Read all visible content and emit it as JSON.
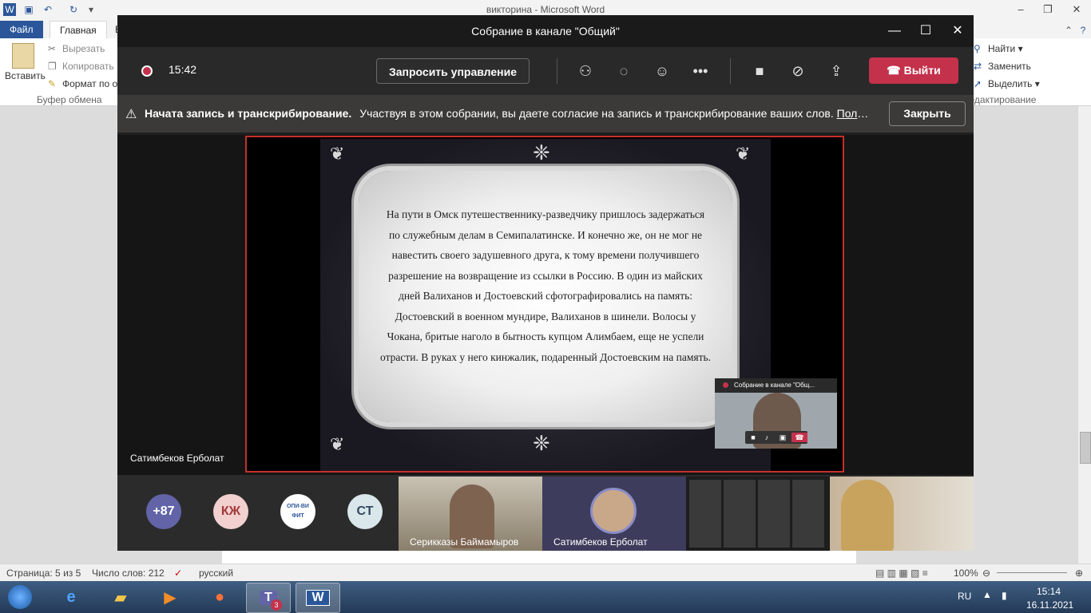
{
  "word": {
    "title": "викторина  -  Microsoft Word",
    "tabs": [
      "Файл",
      "Главная",
      "В"
    ],
    "clipboard": {
      "paste": "Вставить",
      "cut": "Вырезать",
      "copy": "Копировать",
      "format": "Формат по об",
      "group": "Буфер обмена"
    },
    "editing": {
      "find": "Найти",
      "replace": "Заменить",
      "select": "Выделить",
      "group": "Редактирование"
    },
    "status": {
      "page": "Страница: 5 из 5",
      "words": "Число слов: 212",
      "language": "русский",
      "zoom": "100%"
    }
  },
  "teams": {
    "title": "Собрание в канале \"Общий\"",
    "timer": "15:42",
    "request_control": "Запросить управление",
    "leave": "Выйти",
    "banner": {
      "bold": "Начата запись и транскрибирование.",
      "text": "Участвуя в этом собрании, вы даете согласие на запись и транскрибирование ваших слов.",
      "link": "Полити...",
      "close": "Закрыть"
    },
    "slide_text": "На пути в Омск путешественнику-разведчику пришлось задержаться по служебным делам в Семипалатинске. И конечно же, он не мог не навестить своего задушевного друга, к тому времени получившего разрешение на возвращение из ссылки в Россию. В один из майских дней Валиханов и Достоевский сфотографировались на память: Достоевский в военном мундире, Валиханов в шинели. Волосы у Чокана, бритые наголо в бытность купцом Алимбаем, еще не успели отрасти. В руках у него кинжалик, подаренный Достоевским на память.",
    "presenter": "Сатимбеков Ерболат",
    "pip_title": "Собрание в канале \"Общ...",
    "participants": {
      "more": "+87",
      "kzh": "КЖ",
      "logo": "ОПИ-ВИ ФИТ",
      "st": "СТ",
      "tile1": "Серикказы Баймамыров",
      "tile2": "Сатимбеков Ерболат"
    }
  },
  "taskbar": {
    "lang": "RU",
    "time": "15:14",
    "date": "16.11.2021",
    "teams_badge": "3"
  },
  "colors": {
    "word_blue": "#2b579a",
    "teams_red": "#c4314b",
    "teams_purple": "#6264a7"
  }
}
